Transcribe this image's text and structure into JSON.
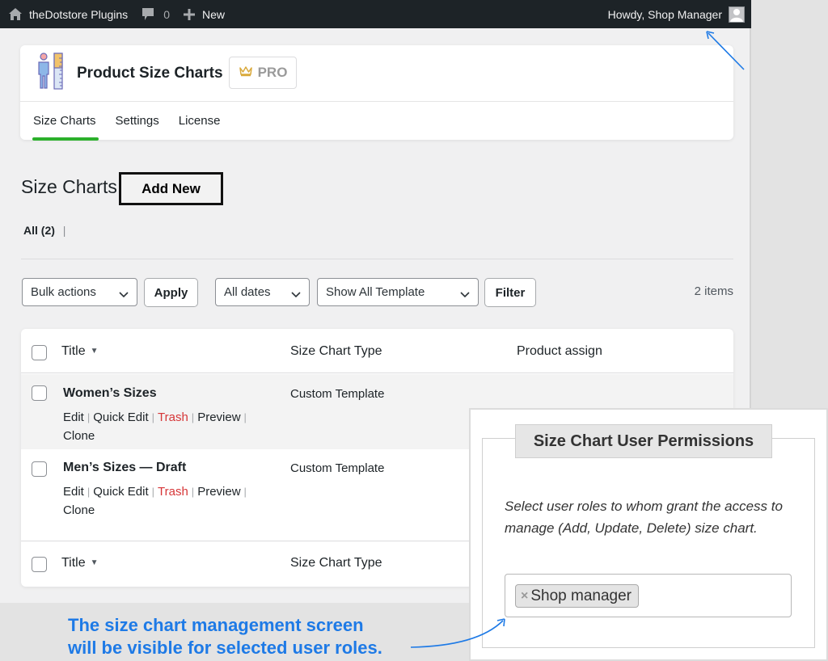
{
  "adminbar": {
    "home_icon": "home-icon",
    "site_name": "theDotstore Plugins",
    "comments_icon": "comment-bubble-icon",
    "comments_count": "0",
    "new_icon": "plus-icon",
    "new_label": "New",
    "greeting": "Howdy, Shop Manager",
    "avatar_icon": "user-avatar-icon"
  },
  "plugin": {
    "logo_icon": "person-ruler-icon",
    "name": "Product Size Charts",
    "pro_icon": "crown-icon",
    "pro_label": "PRO",
    "tabs": [
      {
        "label": "Size Charts",
        "active": true
      },
      {
        "label": "Settings",
        "active": false
      },
      {
        "label": "License",
        "active": false
      }
    ],
    "accent_color": "#2bb02b"
  },
  "page": {
    "title": "Size Charts",
    "add_new_label": "Add New",
    "filter_all": "All (2)",
    "filter_sep": "|"
  },
  "tablenav": {
    "bulk_actions": "Bulk actions",
    "apply_label": "Apply",
    "dates": "All dates",
    "template": "Show All Template",
    "filter_label": "Filter",
    "items_count": "2 items"
  },
  "table": {
    "columns": {
      "title": "Title",
      "sort_icon": "▼",
      "type": "Size Chart Type",
      "assign": "Product assign"
    },
    "rows": [
      {
        "title": "Women’s Sizes",
        "type": "Custom Template",
        "actions": {
          "edit": "Edit",
          "quick_edit": "Quick Edit",
          "trash": "Trash",
          "preview": "Preview",
          "clone": "Clone"
        }
      },
      {
        "title": "Men’s Sizes — Draft",
        "type": "Custom Template",
        "actions": {
          "edit": "Edit",
          "quick_edit": "Quick Edit",
          "trash": "Trash",
          "preview": "Preview",
          "clone": "Clone"
        }
      }
    ],
    "trash_color": "#d63638"
  },
  "permissions": {
    "legend": "Size Chart User Permissions",
    "description": "Select user roles to whom grant the access to manage (Add, Update, Delete) size chart.",
    "selected_roles": [
      {
        "label": "Shop manager",
        "remove_icon": "×"
      }
    ]
  },
  "callout": {
    "line1": "The size chart management screen",
    "line2": "will be visible for selected user roles.",
    "color": "#1e7ae6"
  }
}
